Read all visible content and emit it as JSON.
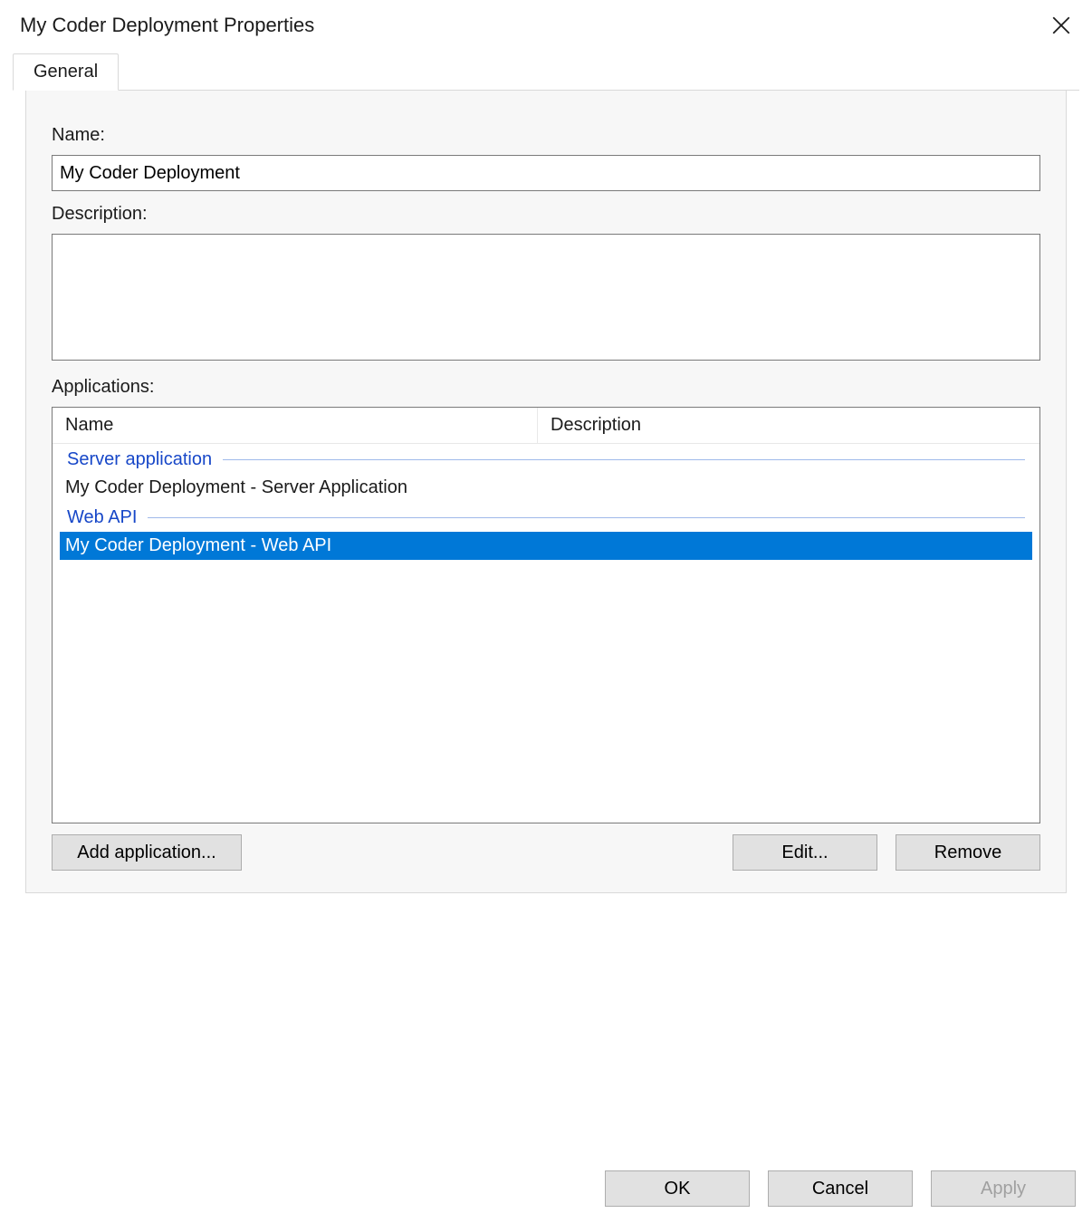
{
  "window": {
    "title": "My Coder Deployment Properties"
  },
  "tabs": {
    "general": "General"
  },
  "form": {
    "name_label": "Name:",
    "name_value": "My Coder Deployment",
    "description_label": "Description:",
    "description_value": "",
    "applications_label": "Applications:"
  },
  "applications": {
    "columns": {
      "name": "Name",
      "description": "Description"
    },
    "groups": [
      {
        "title": "Server application",
        "items": [
          {
            "name": "My Coder Deployment - Server Application",
            "description": "",
            "selected": false
          }
        ]
      },
      {
        "title": "Web API",
        "items": [
          {
            "name": "My Coder Deployment - Web API",
            "description": "",
            "selected": true
          }
        ]
      }
    ],
    "buttons": {
      "add": "Add application...",
      "edit": "Edit...",
      "remove": "Remove"
    }
  },
  "dialog_buttons": {
    "ok": "OK",
    "cancel": "Cancel",
    "apply": "Apply"
  }
}
